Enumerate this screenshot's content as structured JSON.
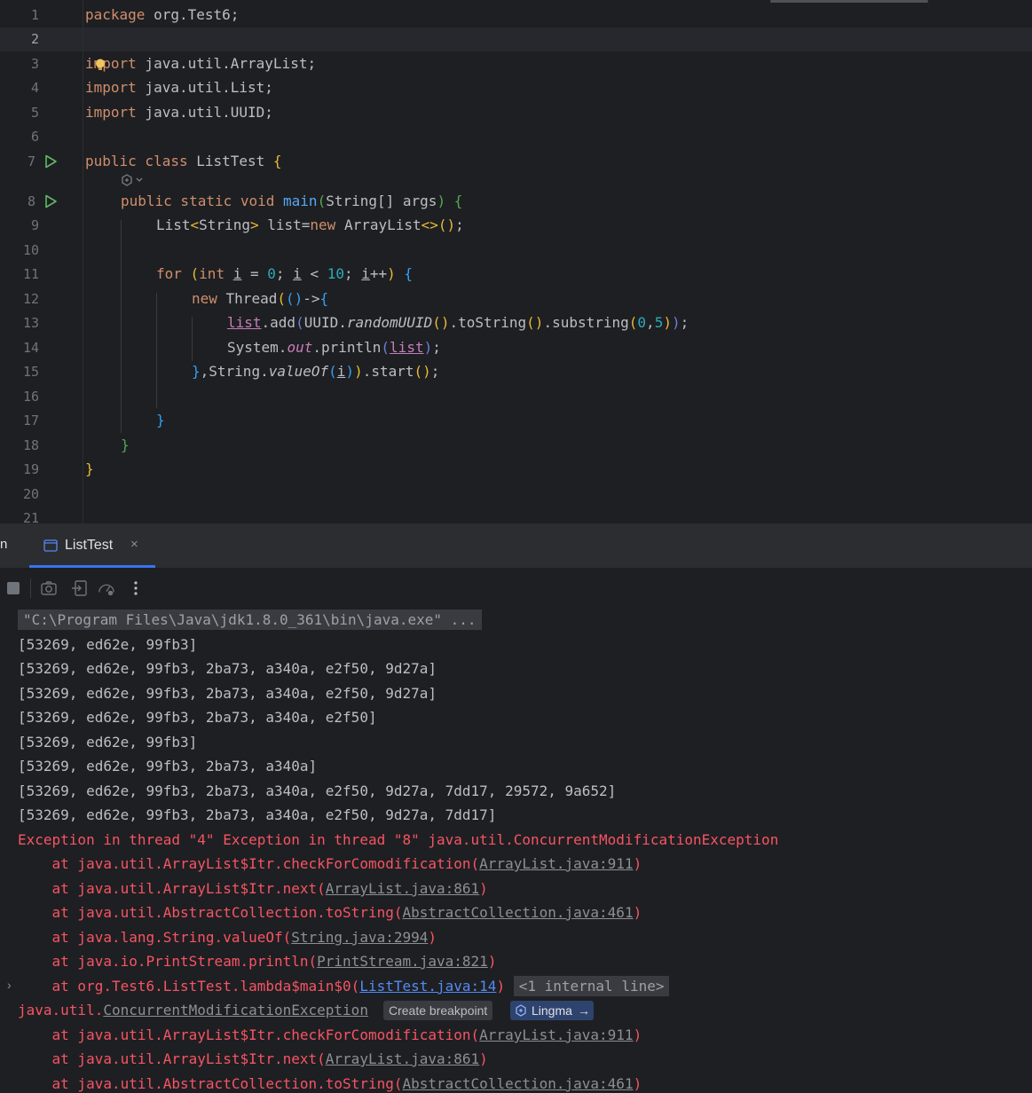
{
  "editor": {
    "line_numbers": [
      "1",
      "2",
      "3",
      "4",
      "5",
      "6",
      "7",
      "8",
      "9",
      "10",
      "11",
      "12",
      "13",
      "14",
      "15",
      "16",
      "17",
      "18",
      "19",
      "20",
      "21"
    ],
    "code": {
      "l1_kw": "package",
      "l1_rest": " org.Test6;",
      "l3_kw": "import",
      "l3_rest": " java.util.ArrayList;",
      "l4_kw": "import",
      "l4_rest": " java.util.List;",
      "l5_kw": "import",
      "l5_rest": " java.util.UUID;",
      "l7_kw": "public class",
      "l7_name": " ListTest ",
      "l7_brace": "{",
      "l8_kw": "public static void",
      "l8_fn": "main",
      "l8_p1": "(",
      "l8_args": "String[] args",
      "l8_p2": ")",
      "l8_brace": " {",
      "l9_a": "List",
      "l9_lt": "<",
      "l9_b": "String",
      "l9_gt": ">",
      "l9_c": " list=",
      "l9_new": "new",
      "l9_d": " ArrayList",
      "l9_e": "<>",
      "l9_f": "()",
      "l9_g": ";",
      "l11_for": "for",
      "l11_p1": " (",
      "l11_int": "int",
      "l11_i1": "i",
      "l11_eq": " = ",
      "l11_zero": "0",
      "l11_semi": "; ",
      "l11_i2": "i",
      "l11_lt": " < ",
      "l11_ten": "10",
      "l11_semi2": "; ",
      "l11_i3": "i",
      "l11_pp": "++",
      "l11_p2": ")",
      "l11_brace": " {",
      "l12_new": "new",
      "l12_thread": " Thread",
      "l12_p": "(",
      "l12_lam": "()",
      "l12_arrow": "->",
      "l12_brace": "{",
      "l13_list": "list",
      "l13_a": ".add",
      "l13_p1": "(",
      "l13_uuid": "UUID.",
      "l13_rand": "randomUUID",
      "l13_rp": "()",
      "l13_ts": ".toString",
      "l13_tp": "()",
      "l13_sub": ".substring",
      "l13_sp1": "(",
      "l13_zero": "0",
      "l13_comma": ",",
      "l13_five": "5",
      "l13_sp2": ")",
      "l13_end": ")",
      "l13_semi": ";",
      "l14_sys": "System.",
      "l14_out": "out",
      "l14_pr": ".println",
      "l14_p1": "(",
      "l14_list": "list",
      "l14_p2": ")",
      "l14_semi": ";",
      "l15_brace": "}",
      "l15_str": ",String.",
      "l15_vo": "valueOf",
      "l15_p1": "(",
      "l15_i": "i",
      "l15_p2": ")",
      "l15_close": ")",
      "l15_start": ".start",
      "l15_sp": "()",
      "l15_semi": ";",
      "l17_brace": "}",
      "l18_brace": "}",
      "l19_brace": "}"
    }
  },
  "tool_window": {
    "cut_label": "n",
    "tab_label": "ListTest",
    "tab_close": "×"
  },
  "console": {
    "cmd": "\"C:\\Program Files\\Java\\jdk1.8.0_361\\bin\\java.exe\" ...",
    "outputs": [
      "[53269, ed62e, 99fb3]",
      "[53269, ed62e, 99fb3, 2ba73, a340a, e2f50, 9d27a]",
      "[53269, ed62e, 99fb3, 2ba73, a340a, e2f50, 9d27a]",
      "[53269, ed62e, 99fb3, 2ba73, a340a, e2f50]",
      "[53269, ed62e, 99fb3]",
      "[53269, ed62e, 99fb3, 2ba73, a340a]",
      "[53269, ed62e, 99fb3, 2ba73, a340a, e2f50, 9d27a, 7dd17, 29572, 9a652]",
      "[53269, ed62e, 99fb3, 2ba73, a340a, e2f50, 9d27a, 7dd17]"
    ],
    "exception_header": "Exception in thread \"4\" Exception in thread \"8\" java.util.ConcurrentModificationException",
    "trace1": [
      {
        "pre": "\tat java.util.ArrayList$Itr.checkForComodification(",
        "link": "ArrayList.java:911",
        "post": ")"
      },
      {
        "pre": "\tat java.util.ArrayList$Itr.next(",
        "link": "ArrayList.java:861",
        "post": ")"
      },
      {
        "pre": "\tat java.util.AbstractCollection.toString(",
        "link": "AbstractCollection.java:461",
        "post": ")"
      },
      {
        "pre": "\tat java.lang.String.valueOf(",
        "link": "String.java:2994",
        "post": ")"
      },
      {
        "pre": "\tat java.io.PrintStream.println(",
        "link": "PrintStream.java:821",
        "post": ")"
      },
      {
        "pre": "\tat org.Test6.ListTest.lambda$main$0(",
        "link": "ListTest.java:14",
        "post": ")"
      }
    ],
    "internal_line": "<1 internal line>",
    "second_exc_prefix": "java.util.",
    "second_exc_link": "ConcurrentModificationException",
    "create_breakpoint": "Create breakpoint",
    "lingma": "Lingma",
    "lingma_arrow": "→",
    "trace2": [
      {
        "pre": "\tat java.util.ArrayList$Itr.checkForComodification(",
        "link": "ArrayList.java:911",
        "post": ")"
      },
      {
        "pre": "\tat java.util.ArrayList$Itr.next(",
        "link": "ArrayList.java:861",
        "post": ")"
      },
      {
        "pre": "\tat java.util.AbstractCollection.toString(",
        "link": "AbstractCollection.java:461",
        "post": ")"
      }
    ],
    "fold_arrow": "›"
  },
  "colors": {
    "background": "#1e1f22",
    "error": "#f75464",
    "accent": "#3574f0",
    "run": "#5fb865"
  },
  "icons": [
    "run-icon",
    "bulb-icon",
    "ai-hint-icon",
    "console-tab-icon",
    "stop-icon",
    "camera-icon",
    "exit-icon",
    "speedometer-icon",
    "more-icon",
    "lingma-icon"
  ]
}
